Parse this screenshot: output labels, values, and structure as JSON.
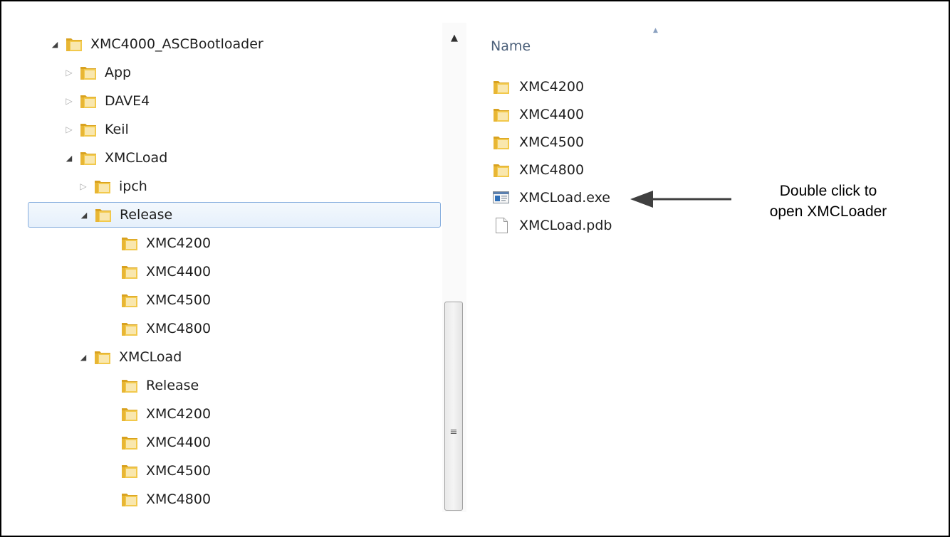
{
  "tree": {
    "items": [
      {
        "label": "XMC4000_ASCBootloader",
        "depth": 0,
        "expander": "expanded",
        "icon": "folder-icon",
        "selected": false
      },
      {
        "label": "App",
        "depth": 1,
        "expander": "collapsed",
        "icon": "folder-icon",
        "selected": false
      },
      {
        "label": "DAVE4",
        "depth": 1,
        "expander": "collapsed",
        "icon": "folder-icon",
        "selected": false
      },
      {
        "label": "Keil",
        "depth": 1,
        "expander": "collapsed",
        "icon": "folder-icon",
        "selected": false
      },
      {
        "label": "XMCLoad",
        "depth": 1,
        "expander": "expanded",
        "icon": "folder-icon",
        "selected": false
      },
      {
        "label": "ipch",
        "depth": 2,
        "expander": "collapsed",
        "icon": "folder-icon",
        "selected": false
      },
      {
        "label": "Release",
        "depth": 2,
        "expander": "expanded",
        "icon": "folder-icon",
        "selected": true
      },
      {
        "label": "XMC4200",
        "depth": 3,
        "expander": "none",
        "icon": "folder-icon",
        "selected": false
      },
      {
        "label": "XMC4400",
        "depth": 3,
        "expander": "none",
        "icon": "folder-icon",
        "selected": false
      },
      {
        "label": "XMC4500",
        "depth": 3,
        "expander": "none",
        "icon": "folder-icon",
        "selected": false
      },
      {
        "label": "XMC4800",
        "depth": 3,
        "expander": "none",
        "icon": "folder-icon",
        "selected": false
      },
      {
        "label": "XMCLoad",
        "depth": 2,
        "expander": "expanded",
        "icon": "folder-icon",
        "selected": false
      },
      {
        "label": "Release",
        "depth": 3,
        "expander": "none",
        "icon": "folder-icon",
        "selected": false
      },
      {
        "label": "XMC4200",
        "depth": 3,
        "expander": "none",
        "icon": "folder-icon",
        "selected": false
      },
      {
        "label": "XMC4400",
        "depth": 3,
        "expander": "none",
        "icon": "folder-icon",
        "selected": false
      },
      {
        "label": "XMC4500",
        "depth": 3,
        "expander": "none",
        "icon": "folder-icon",
        "selected": false
      },
      {
        "label": "XMC4800",
        "depth": 3,
        "expander": "none",
        "icon": "folder-icon",
        "selected": false
      }
    ]
  },
  "scrollbar": {
    "up_arrow": "▲",
    "grip": "≡"
  },
  "content": {
    "column_header": "Name",
    "sort_indicator": "▲",
    "files": [
      {
        "label": "XMC4200",
        "icon": "folder-icon"
      },
      {
        "label": "XMC4400",
        "icon": "folder-icon"
      },
      {
        "label": "XMC4500",
        "icon": "folder-icon"
      },
      {
        "label": "XMC4800",
        "icon": "folder-icon"
      },
      {
        "label": "XMCLoad.exe",
        "icon": "application-icon"
      },
      {
        "label": "XMCLoad.pdb",
        "icon": "document-icon"
      }
    ]
  },
  "annotation": {
    "line1": "Double click to",
    "line2": "open XMCLoader"
  },
  "colors": {
    "folder": "#e8b634",
    "selection_border": "#84acdd",
    "header_text": "#4c607a"
  }
}
